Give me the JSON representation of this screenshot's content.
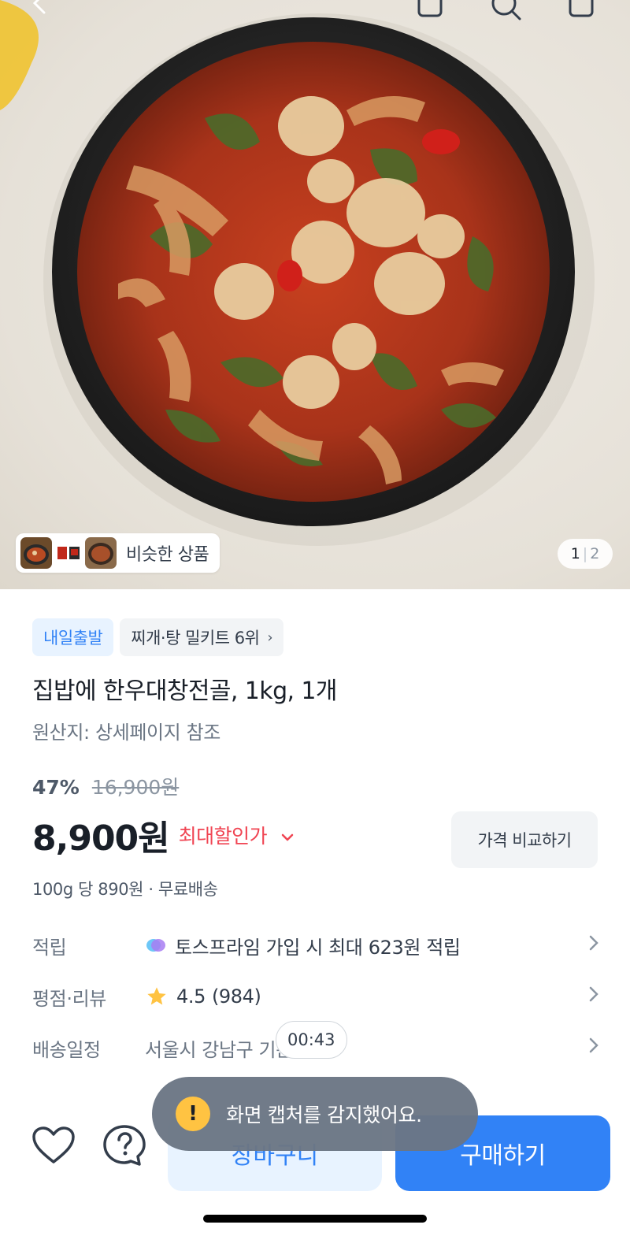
{
  "similar_products": {
    "label": "비슷한 상품"
  },
  "image_pager": {
    "current": "1",
    "separator": "|",
    "total": "2"
  },
  "badges": {
    "delivery": "내일출발",
    "ranking": "찌개·탕 밀키트 6위",
    "ranking_chevron": "›"
  },
  "product": {
    "title": "집밥에 한우대창전골, 1kg, 1개",
    "origin": "원산지: 상세페이지 참조",
    "discount_rate": "47%",
    "original_price": "16,900원",
    "price": "8,900원",
    "max_discount_label": "최대할인가",
    "compare_button": "가격 비교하기",
    "unit_price": "100g 당 890원 · 무료배송"
  },
  "info_rows": {
    "points": {
      "label": "적립",
      "value": "토스프라임 가입 시 최대 623원 적립",
      "icon": "toss-prime-icon"
    },
    "rating": {
      "label": "평점·리뷰",
      "score": "4.5",
      "count": "(984)",
      "icon": "star-icon"
    },
    "delivery": {
      "label": "배송일정",
      "value": "서울시 강남구 기준"
    }
  },
  "timer": "00:43",
  "toast": {
    "icon": "!",
    "message": "화면 캡처를 감지했어요."
  },
  "bottom_bar": {
    "cart_label": "장바구니",
    "buy_label": "구매하기"
  },
  "colors": {
    "accent": "#3182f6",
    "accent_light": "#e8f3ff",
    "sale_red": "#f04452",
    "toast_yellow": "#ffc342"
  }
}
